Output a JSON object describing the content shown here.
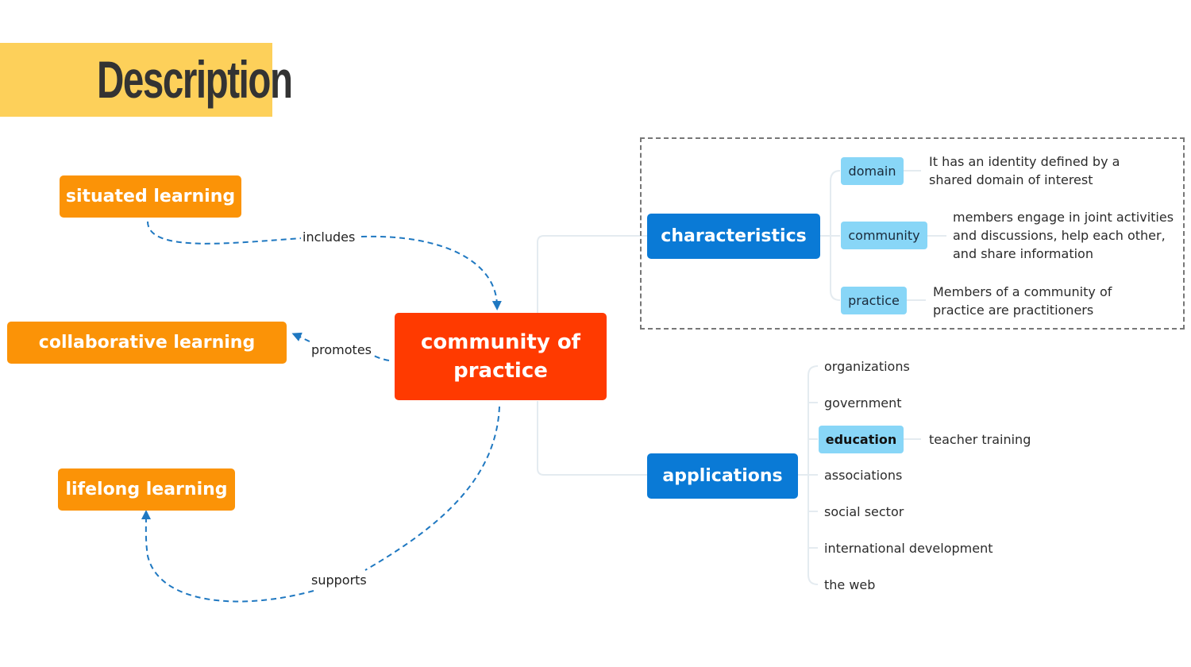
{
  "header": {
    "title": "Description"
  },
  "central_node": {
    "label": "community of practice"
  },
  "related_nodes": [
    {
      "label": "situated learning",
      "relation": "includes",
      "direction": "to-center"
    },
    {
      "label": "collaborative learning",
      "relation": "promotes",
      "direction": "from-center"
    },
    {
      "label": "lifelong learning",
      "relation": "supports",
      "direction": "from-center"
    }
  ],
  "branches": {
    "characteristics": {
      "label": "characteristics",
      "items": [
        {
          "label": "domain",
          "description": [
            "It has an identity defined by a",
            "shared domain of interest"
          ]
        },
        {
          "label": "community",
          "description": [
            "members engage in joint activities",
            "and discussions, help each other,",
            "and share information"
          ]
        },
        {
          "label": "practice",
          "description": [
            "Members of a community of",
            "practice are practitioners"
          ]
        }
      ]
    },
    "applications": {
      "label": "applications",
      "items": [
        {
          "label": "organizations"
        },
        {
          "label": "government"
        },
        {
          "label": "education",
          "highlighted": true,
          "child": "teacher training"
        },
        {
          "label": "associations"
        },
        {
          "label": "social sector"
        },
        {
          "label": "international development"
        },
        {
          "label": "the web"
        }
      ]
    }
  },
  "colors": {
    "title_band": "#fdd05a",
    "related_node": "#fb9307",
    "central_node": "#ff3a00",
    "branch_node": "#0a7ad6",
    "sub_chip": "#88d6f7",
    "relation_line": "#1f78c1"
  }
}
